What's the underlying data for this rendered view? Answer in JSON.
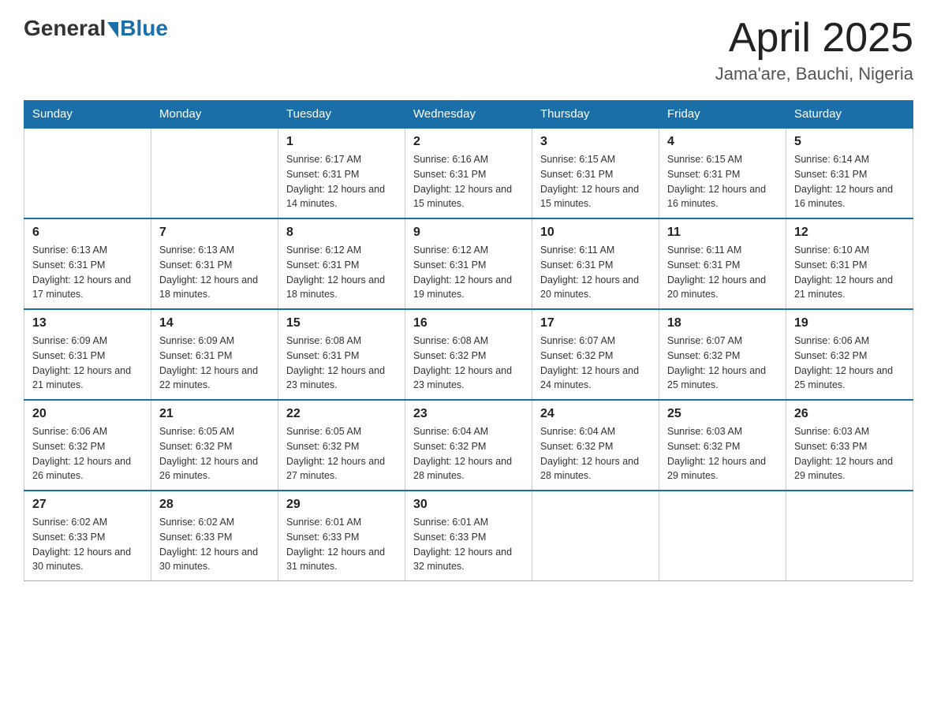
{
  "header": {
    "logo_general": "General",
    "logo_blue": "Blue",
    "month": "April 2025",
    "location": "Jama'are, Bauchi, Nigeria"
  },
  "days_of_week": [
    "Sunday",
    "Monday",
    "Tuesday",
    "Wednesday",
    "Thursday",
    "Friday",
    "Saturday"
  ],
  "weeks": [
    [
      {
        "day": "",
        "sunrise": "",
        "sunset": "",
        "daylight": ""
      },
      {
        "day": "",
        "sunrise": "",
        "sunset": "",
        "daylight": ""
      },
      {
        "day": "1",
        "sunrise": "Sunrise: 6:17 AM",
        "sunset": "Sunset: 6:31 PM",
        "daylight": "Daylight: 12 hours and 14 minutes."
      },
      {
        "day": "2",
        "sunrise": "Sunrise: 6:16 AM",
        "sunset": "Sunset: 6:31 PM",
        "daylight": "Daylight: 12 hours and 15 minutes."
      },
      {
        "day": "3",
        "sunrise": "Sunrise: 6:15 AM",
        "sunset": "Sunset: 6:31 PM",
        "daylight": "Daylight: 12 hours and 15 minutes."
      },
      {
        "day": "4",
        "sunrise": "Sunrise: 6:15 AM",
        "sunset": "Sunset: 6:31 PM",
        "daylight": "Daylight: 12 hours and 16 minutes."
      },
      {
        "day": "5",
        "sunrise": "Sunrise: 6:14 AM",
        "sunset": "Sunset: 6:31 PM",
        "daylight": "Daylight: 12 hours and 16 minutes."
      }
    ],
    [
      {
        "day": "6",
        "sunrise": "Sunrise: 6:13 AM",
        "sunset": "Sunset: 6:31 PM",
        "daylight": "Daylight: 12 hours and 17 minutes."
      },
      {
        "day": "7",
        "sunrise": "Sunrise: 6:13 AM",
        "sunset": "Sunset: 6:31 PM",
        "daylight": "Daylight: 12 hours and 18 minutes."
      },
      {
        "day": "8",
        "sunrise": "Sunrise: 6:12 AM",
        "sunset": "Sunset: 6:31 PM",
        "daylight": "Daylight: 12 hours and 18 minutes."
      },
      {
        "day": "9",
        "sunrise": "Sunrise: 6:12 AM",
        "sunset": "Sunset: 6:31 PM",
        "daylight": "Daylight: 12 hours and 19 minutes."
      },
      {
        "day": "10",
        "sunrise": "Sunrise: 6:11 AM",
        "sunset": "Sunset: 6:31 PM",
        "daylight": "Daylight: 12 hours and 20 minutes."
      },
      {
        "day": "11",
        "sunrise": "Sunrise: 6:11 AM",
        "sunset": "Sunset: 6:31 PM",
        "daylight": "Daylight: 12 hours and 20 minutes."
      },
      {
        "day": "12",
        "sunrise": "Sunrise: 6:10 AM",
        "sunset": "Sunset: 6:31 PM",
        "daylight": "Daylight: 12 hours and 21 minutes."
      }
    ],
    [
      {
        "day": "13",
        "sunrise": "Sunrise: 6:09 AM",
        "sunset": "Sunset: 6:31 PM",
        "daylight": "Daylight: 12 hours and 21 minutes."
      },
      {
        "day": "14",
        "sunrise": "Sunrise: 6:09 AM",
        "sunset": "Sunset: 6:31 PM",
        "daylight": "Daylight: 12 hours and 22 minutes."
      },
      {
        "day": "15",
        "sunrise": "Sunrise: 6:08 AM",
        "sunset": "Sunset: 6:31 PM",
        "daylight": "Daylight: 12 hours and 23 minutes."
      },
      {
        "day": "16",
        "sunrise": "Sunrise: 6:08 AM",
        "sunset": "Sunset: 6:32 PM",
        "daylight": "Daylight: 12 hours and 23 minutes."
      },
      {
        "day": "17",
        "sunrise": "Sunrise: 6:07 AM",
        "sunset": "Sunset: 6:32 PM",
        "daylight": "Daylight: 12 hours and 24 minutes."
      },
      {
        "day": "18",
        "sunrise": "Sunrise: 6:07 AM",
        "sunset": "Sunset: 6:32 PM",
        "daylight": "Daylight: 12 hours and 25 minutes."
      },
      {
        "day": "19",
        "sunrise": "Sunrise: 6:06 AM",
        "sunset": "Sunset: 6:32 PM",
        "daylight": "Daylight: 12 hours and 25 minutes."
      }
    ],
    [
      {
        "day": "20",
        "sunrise": "Sunrise: 6:06 AM",
        "sunset": "Sunset: 6:32 PM",
        "daylight": "Daylight: 12 hours and 26 minutes."
      },
      {
        "day": "21",
        "sunrise": "Sunrise: 6:05 AM",
        "sunset": "Sunset: 6:32 PM",
        "daylight": "Daylight: 12 hours and 26 minutes."
      },
      {
        "day": "22",
        "sunrise": "Sunrise: 6:05 AM",
        "sunset": "Sunset: 6:32 PM",
        "daylight": "Daylight: 12 hours and 27 minutes."
      },
      {
        "day": "23",
        "sunrise": "Sunrise: 6:04 AM",
        "sunset": "Sunset: 6:32 PM",
        "daylight": "Daylight: 12 hours and 28 minutes."
      },
      {
        "day": "24",
        "sunrise": "Sunrise: 6:04 AM",
        "sunset": "Sunset: 6:32 PM",
        "daylight": "Daylight: 12 hours and 28 minutes."
      },
      {
        "day": "25",
        "sunrise": "Sunrise: 6:03 AM",
        "sunset": "Sunset: 6:32 PM",
        "daylight": "Daylight: 12 hours and 29 minutes."
      },
      {
        "day": "26",
        "sunrise": "Sunrise: 6:03 AM",
        "sunset": "Sunset: 6:33 PM",
        "daylight": "Daylight: 12 hours and 29 minutes."
      }
    ],
    [
      {
        "day": "27",
        "sunrise": "Sunrise: 6:02 AM",
        "sunset": "Sunset: 6:33 PM",
        "daylight": "Daylight: 12 hours and 30 minutes."
      },
      {
        "day": "28",
        "sunrise": "Sunrise: 6:02 AM",
        "sunset": "Sunset: 6:33 PM",
        "daylight": "Daylight: 12 hours and 30 minutes."
      },
      {
        "day": "29",
        "sunrise": "Sunrise: 6:01 AM",
        "sunset": "Sunset: 6:33 PM",
        "daylight": "Daylight: 12 hours and 31 minutes."
      },
      {
        "day": "30",
        "sunrise": "Sunrise: 6:01 AM",
        "sunset": "Sunset: 6:33 PM",
        "daylight": "Daylight: 12 hours and 32 minutes."
      },
      {
        "day": "",
        "sunrise": "",
        "sunset": "",
        "daylight": ""
      },
      {
        "day": "",
        "sunrise": "",
        "sunset": "",
        "daylight": ""
      },
      {
        "day": "",
        "sunrise": "",
        "sunset": "",
        "daylight": ""
      }
    ]
  ]
}
